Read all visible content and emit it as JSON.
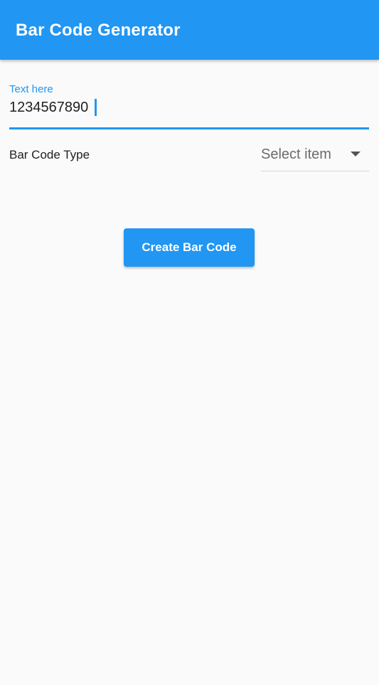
{
  "app_bar": {
    "title": "Bar Code Generator",
    "background_color": "#2196f3"
  },
  "text_field": {
    "label": "Text here",
    "value": "1234567890",
    "accent_color": "#2196f3"
  },
  "barcode_type": {
    "label": "Bar Code Type",
    "dropdown_hint": "Select item",
    "dropdown_icon": "arrow-drop-down-icon"
  },
  "create_button": {
    "label": "Create Bar Code",
    "color": "#2196f3"
  }
}
